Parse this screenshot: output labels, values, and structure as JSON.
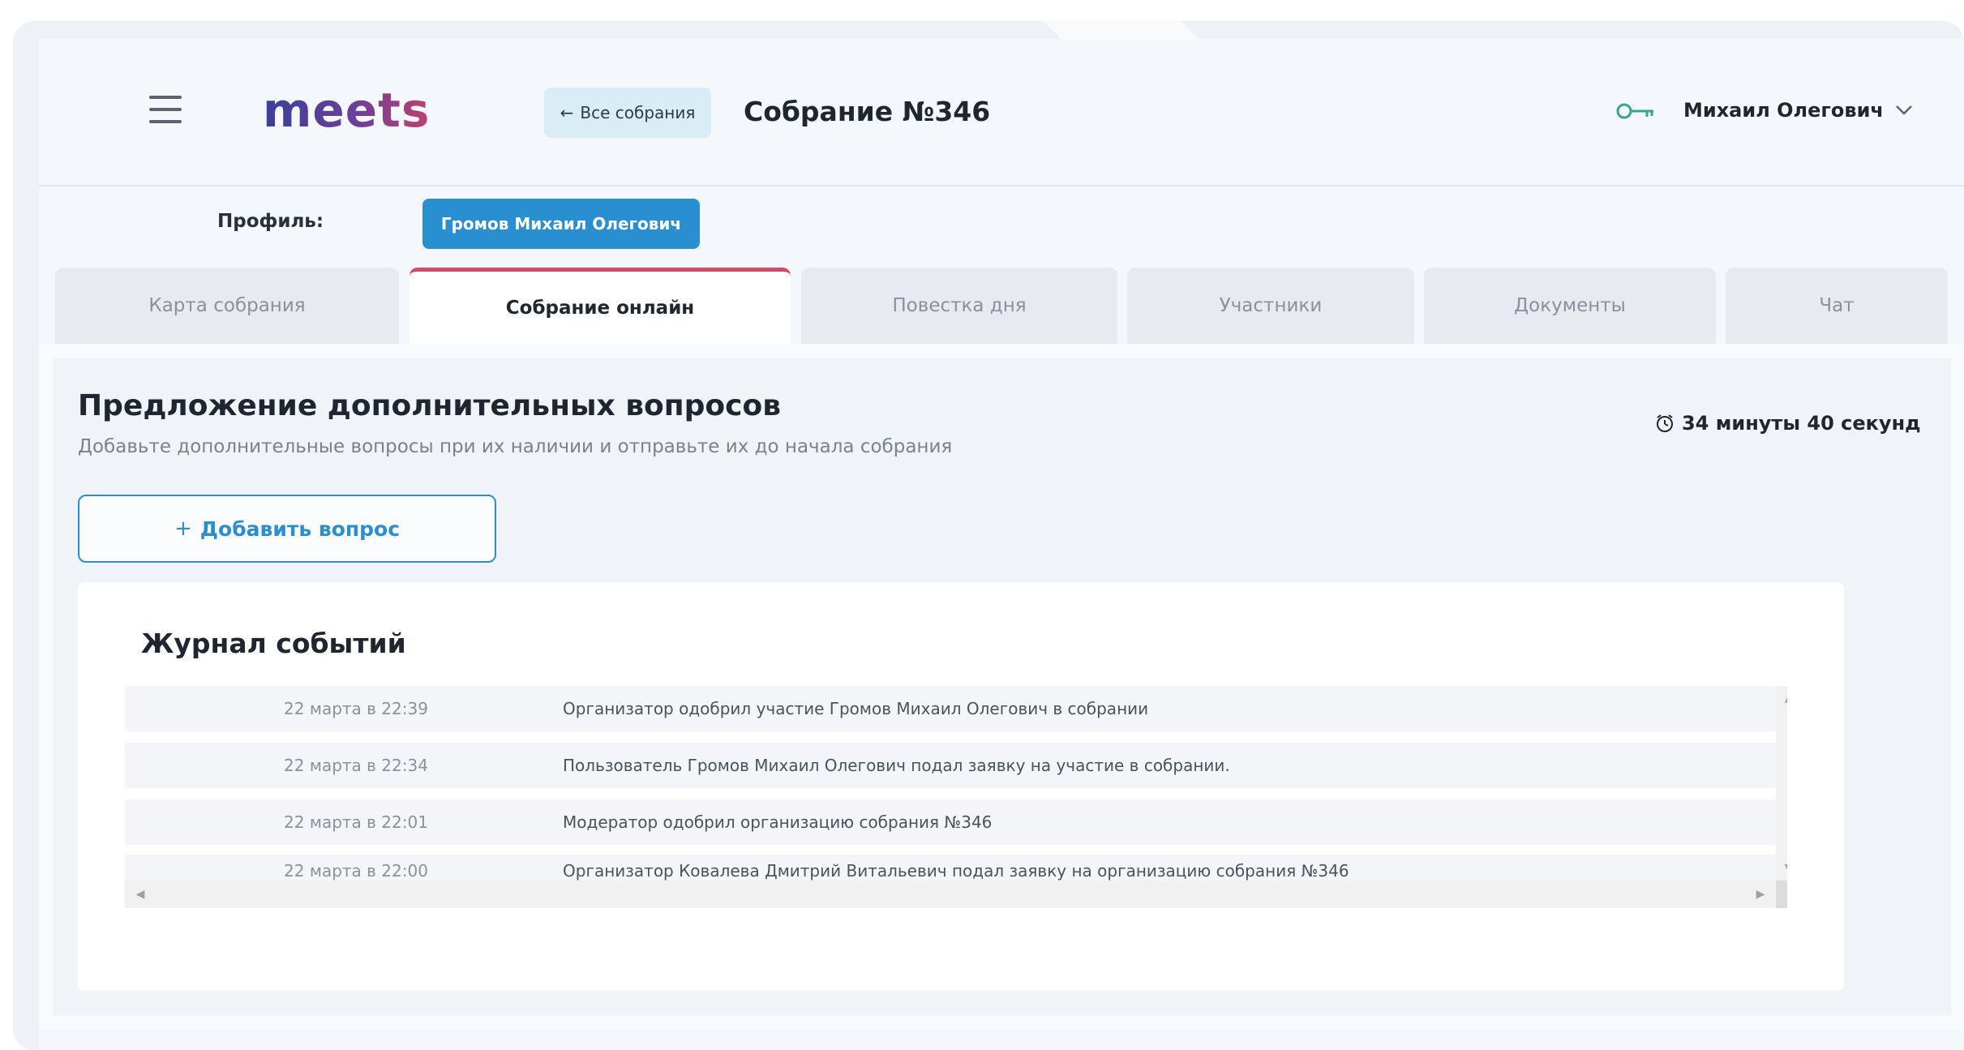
{
  "header": {
    "logo": "meets",
    "back_label": "Все собрания",
    "title": "Собрание №346",
    "user_name": "Михаил Олегович"
  },
  "profile": {
    "label": "Профиль:",
    "value": "Громов Михаил Олегович"
  },
  "tabs": [
    {
      "label": "Карта собрания",
      "active": false
    },
    {
      "label": "Собрание онлайн",
      "active": true
    },
    {
      "label": "Повестка дня",
      "active": false
    },
    {
      "label": "Участники",
      "active": false
    },
    {
      "label": "Документы",
      "active": false
    },
    {
      "label": "Чат",
      "active": false
    }
  ],
  "section": {
    "title": "Предложение дополнительных вопросов",
    "subtitle": "Добавьте дополнительные вопросы при их наличии и отправьте их до начала собрания",
    "timer": "34 минуты 40 секунд",
    "add_label": "Добавить вопрос"
  },
  "log": {
    "title": "Журнал событий",
    "rows": [
      {
        "date": "22 марта в 22:39",
        "message": "Организатор одобрил участие Громов Михаил Олегович в собрании"
      },
      {
        "date": "22 марта в 22:34",
        "message": "Пользователь Громов Михаил Олегович подал заявку на участие в собрании."
      },
      {
        "date": "22 марта в 22:01",
        "message": "Модератор одобрил организацию собрания №346"
      },
      {
        "date": "22 марта в 22:00",
        "message": "Организатор Ковалева Дмитрий Витальевич подал заявку на организацию собрания №346"
      }
    ]
  },
  "colors": {
    "accent": "#2a8fd0",
    "active_tab_border": "#d14a66",
    "key_icon": "#3aa58f"
  },
  "icons": {
    "menu": "hamburger-icon",
    "back": "arrow-left-icon",
    "key": "key-icon",
    "chevron": "chevron-down-icon",
    "timer": "alarm-clock-icon",
    "plus": "plus-icon"
  }
}
